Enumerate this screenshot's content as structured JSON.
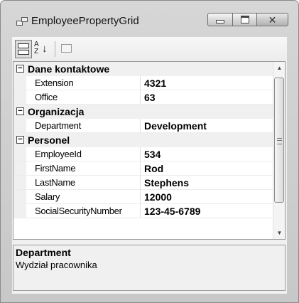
{
  "window": {
    "title": "EmployeePropertyGrid"
  },
  "toolbar": {
    "categorized_icon": "categorized-view-icon",
    "alphabetical_icon": "sort-alphabetical-icon",
    "alpha_glyph_top": "A",
    "alpha_glyph_bottom": "Z",
    "property_pages_icon": "property-pages-icon"
  },
  "grid": {
    "categories": [
      {
        "label": "Dane kontaktowe",
        "toggle": "−",
        "properties": [
          {
            "name": "Extension",
            "value": "4321"
          },
          {
            "name": "Office",
            "value": "63"
          }
        ]
      },
      {
        "label": "Organizacja",
        "toggle": "−",
        "properties": [
          {
            "name": "Department",
            "value": "Development"
          }
        ]
      },
      {
        "label": "Personel",
        "toggle": "−",
        "properties": [
          {
            "name": "EmployeeId",
            "value": "534"
          },
          {
            "name": "FirstName",
            "value": "Rod"
          },
          {
            "name": "LastName",
            "value": "Stephens"
          },
          {
            "name": "Salary",
            "value": "12000"
          },
          {
            "name": "SocialSecurityNumber",
            "value": "123-45-6789"
          }
        ]
      }
    ]
  },
  "help": {
    "title": "Department",
    "description": "Wydział pracownika"
  },
  "colors": {
    "frame": "#c8c8c8",
    "grid_background": "#ffffff",
    "category_background": "#f0f0f0"
  }
}
